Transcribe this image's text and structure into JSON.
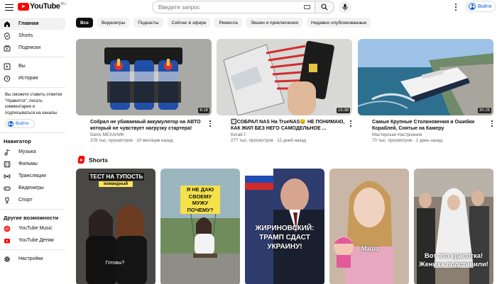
{
  "header": {
    "logo_text": "YouTube",
    "logo_region": "RU",
    "search_placeholder": "Введите запрос",
    "signin_label": "Войти"
  },
  "sidebar": {
    "main_items": [
      {
        "label": "Главная",
        "icon": "home-icon",
        "active": true
      },
      {
        "label": "Shorts",
        "icon": "shorts-icon"
      },
      {
        "label": "Подписки",
        "icon": "subscriptions-icon"
      }
    ],
    "you_items": [
      {
        "label": "Вы",
        "icon": "you-icon"
      },
      {
        "label": "История",
        "icon": "history-icon"
      }
    ],
    "signin_note": "Вы сможете ставить отметки \"Нравится\", писать комментарии и подписываться на каналы.",
    "signin_label": "Войти",
    "nav_heading": "Навигатор",
    "nav_items": [
      {
        "label": "Музыка",
        "icon": "music-icon"
      },
      {
        "label": "Фильмы",
        "icon": "movies-icon"
      },
      {
        "label": "Трансляции",
        "icon": "live-icon"
      },
      {
        "label": "Видеоигры",
        "icon": "gaming-icon"
      },
      {
        "label": "Спорт",
        "icon": "sport-icon"
      }
    ],
    "more_heading": "Другие возможности",
    "more_items": [
      {
        "label": "YouTube Music",
        "icon": "youtube-music-icon"
      },
      {
        "label": "YouTube Детям",
        "icon": "youtube-kids-icon"
      }
    ],
    "settings_label": "Настройки"
  },
  "chips": [
    "Все",
    "Видеоигры",
    "Подкасты",
    "Сейчас в эфире",
    "Ремесла",
    "Экшен и приключения",
    "Недавно опубликованные"
  ],
  "videos": [
    {
      "title": "Собрал не убиваемый аккумулятор на АВТО который не чувствует нагрузку стартера!",
      "channel": "Denis МЕХАНИК",
      "meta": "378 тыс. просмотров · 10 месяцев назад",
      "duration": "6:18"
    },
    {
      "title": "🔲СОБРАЛ NAS На TrueNAS😉 НЕ ПОНИМАЮ, КАК ЖИЛ БЕЗ НЕГО САМОДЕЛЬНОЕ ...",
      "channel": "Китай Г.",
      "meta": "277 тыс. просмотров · 12 дней назад",
      "duration": "15:38"
    },
    {
      "title": "Самые Крупные Столкновения и Ошибки Кораблей, Снятые на Камеру",
      "channel": "Мастерская Настроения",
      "meta": "70 тыс. просмотров · 1 день назад",
      "duration": "30:25"
    }
  ],
  "shorts_heading": "Shorts",
  "shorts": [
    {
      "caption_top": "ТЕСТ НА ТУПОСТЬ",
      "caption_sub": "командный",
      "caption_bottom": "Готовы?"
    },
    {
      "caption_top": "Я НЕ ДАЮ СВОЕМУ МУЖУ ПОЧЕМУ?"
    },
    {
      "caption_top": "ЖИРИНОВСКИЙ: ТРАМП СДАСТ УКРАИНУ!"
    },
    {
      "caption_top": "Маша"
    },
    {
      "caption_top": "Вот это красотка! Жениха подставили!"
    }
  ]
}
